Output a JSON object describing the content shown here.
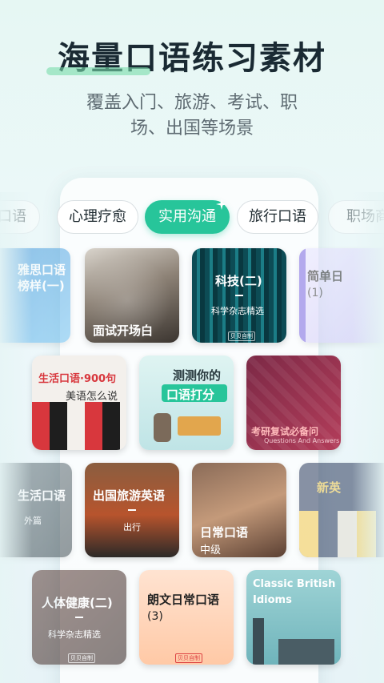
{
  "header": {
    "title": "海量口语练习素材",
    "subtitle_line1": "覆盖入门、旅游、考试、职",
    "subtitle_line2": "场、出国等场景"
  },
  "tabs": [
    {
      "label": "口语",
      "active": false
    },
    {
      "label": "心理疗愈",
      "active": false
    },
    {
      "label": "实用沟通",
      "active": true
    },
    {
      "label": "旅行口语",
      "active": false
    },
    {
      "label": "职场商",
      "active": false
    }
  ],
  "cards": {
    "row1": [
      {
        "title": "雅思口语",
        "subtitle": "榜样(一)"
      },
      {
        "title": "面试开场白"
      },
      {
        "title": "科技(二)",
        "subtitle": "科学杂志精选",
        "stamp": "贝贝自制"
      },
      {
        "title": "简单日",
        "subtitle": "(1)"
      }
    ],
    "row2": [
      {
        "title": "生活口语·900句",
        "subtitle": "美语怎么说"
      },
      {
        "title": "测测你的",
        "subtitle": "口语打分"
      },
      {
        "title": "考研复试必备问",
        "subtitle": "Questions And Answers"
      }
    ],
    "row3": [
      {
        "title": "生活口语",
        "subtitle": "外篇"
      },
      {
        "title": "出国旅游英语",
        "subtitle": "出行"
      },
      {
        "title": "日常口语",
        "subtitle": "中级"
      },
      {
        "title": "新英"
      }
    ],
    "row4": [
      {
        "title": "人体健康(二)",
        "subtitle": "科学杂志精选",
        "stamp": "贝贝自制"
      },
      {
        "title": "朗文日常口语",
        "subtitle": "(3)",
        "stamp": "贝贝自制"
      },
      {
        "title": "Classic British",
        "subtitle": "Idioms"
      }
    ]
  }
}
